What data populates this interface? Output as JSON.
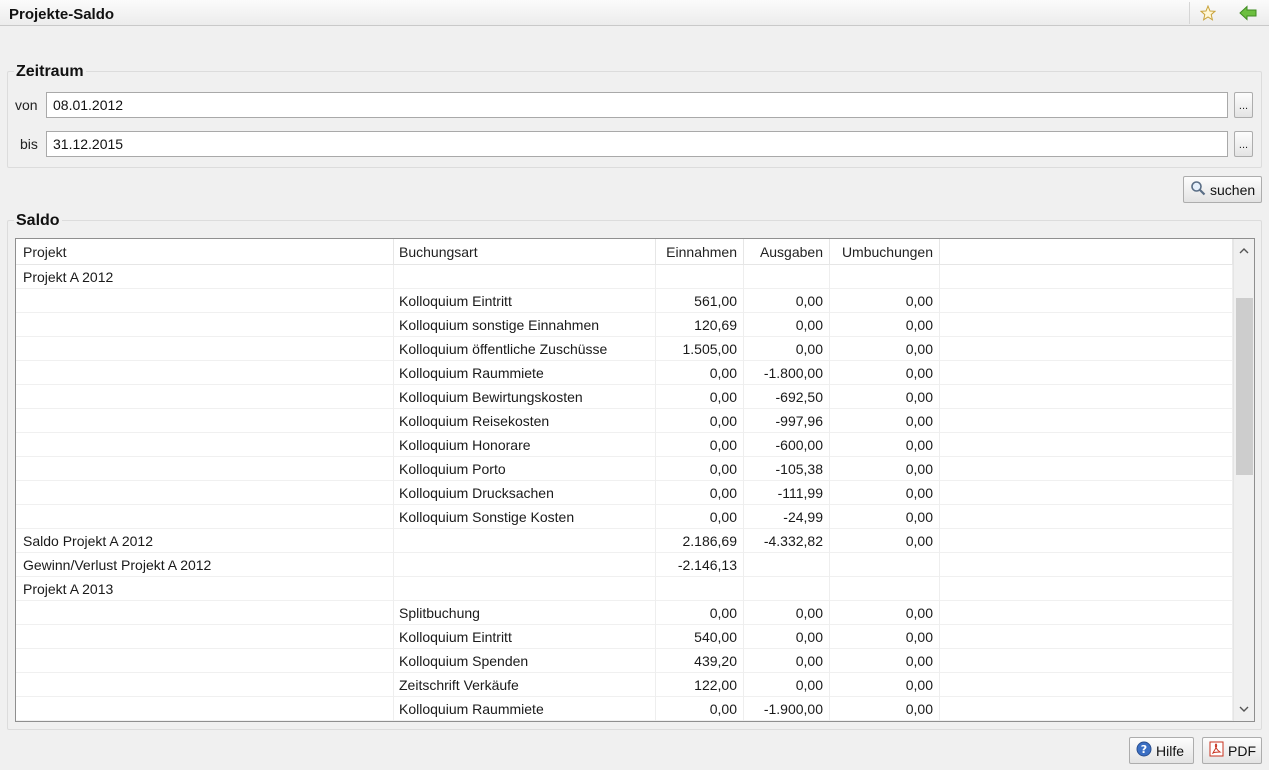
{
  "window": {
    "title": "Projekte-Saldo",
    "icons": [
      "star-icon",
      "back-arrow-icon"
    ]
  },
  "zeitraum": {
    "title": "Zeitraum",
    "von_label": "von",
    "von_value": "08.01.2012",
    "bis_label": "bis",
    "bis_value": "31.12.2015",
    "picker_label": "..."
  },
  "search": {
    "label": "suchen",
    "icon": "magnifier-icon"
  },
  "saldo": {
    "title": "Saldo",
    "columns": {
      "projekt": "Projekt",
      "buchungsart": "Buchungsart",
      "einnahmen": "Einnahmen",
      "ausgaben": "Ausgaben",
      "umbuchungen": "Umbuchungen"
    },
    "rows": [
      {
        "projekt": "Projekt A 2012",
        "buchungsart": "",
        "einnahmen": "",
        "ausgaben": "",
        "umbuchungen": ""
      },
      {
        "projekt": "",
        "buchungsart": "Kolloquium Eintritt",
        "einnahmen": "561,00",
        "ausgaben": "0,00",
        "umbuchungen": "0,00"
      },
      {
        "projekt": "",
        "buchungsart": "Kolloquium sonstige Einnahmen",
        "einnahmen": "120,69",
        "ausgaben": "0,00",
        "umbuchungen": "0,00"
      },
      {
        "projekt": "",
        "buchungsart": "Kolloquium öffentliche Zuschüsse",
        "einnahmen": "1.505,00",
        "ausgaben": "0,00",
        "umbuchungen": "0,00"
      },
      {
        "projekt": "",
        "buchungsart": "Kolloquium Raummiete",
        "einnahmen": "0,00",
        "ausgaben": "-1.800,00",
        "umbuchungen": "0,00"
      },
      {
        "projekt": "",
        "buchungsart": "Kolloquium Bewirtungskosten",
        "einnahmen": "0,00",
        "ausgaben": "-692,50",
        "umbuchungen": "0,00"
      },
      {
        "projekt": "",
        "buchungsart": "Kolloquium Reisekosten",
        "einnahmen": "0,00",
        "ausgaben": "-997,96",
        "umbuchungen": "0,00"
      },
      {
        "projekt": "",
        "buchungsart": "Kolloquium Honorare",
        "einnahmen": "0,00",
        "ausgaben": "-600,00",
        "umbuchungen": "0,00"
      },
      {
        "projekt": "",
        "buchungsart": "Kolloquium Porto",
        "einnahmen": "0,00",
        "ausgaben": "-105,38",
        "umbuchungen": "0,00"
      },
      {
        "projekt": "",
        "buchungsart": "Kolloquium Drucksachen",
        "einnahmen": "0,00",
        "ausgaben": "-111,99",
        "umbuchungen": "0,00"
      },
      {
        "projekt": "",
        "buchungsart": "Kolloquium Sonstige Kosten",
        "einnahmen": "0,00",
        "ausgaben": "-24,99",
        "umbuchungen": "0,00"
      },
      {
        "projekt": "Saldo Projekt A 2012",
        "buchungsart": "",
        "einnahmen": "2.186,69",
        "ausgaben": "-4.332,82",
        "umbuchungen": "0,00"
      },
      {
        "projekt": "Gewinn/Verlust Projekt A 2012",
        "buchungsart": "",
        "einnahmen": "-2.146,13",
        "ausgaben": "",
        "umbuchungen": ""
      },
      {
        "projekt": "Projekt A 2013",
        "buchungsart": "",
        "einnahmen": "",
        "ausgaben": "",
        "umbuchungen": ""
      },
      {
        "projekt": "",
        "buchungsart": "Splitbuchung",
        "einnahmen": "0,00",
        "ausgaben": "0,00",
        "umbuchungen": "0,00"
      },
      {
        "projekt": "",
        "buchungsart": "Kolloquium Eintritt",
        "einnahmen": "540,00",
        "ausgaben": "0,00",
        "umbuchungen": "0,00"
      },
      {
        "projekt": "",
        "buchungsart": "Kolloquium Spenden",
        "einnahmen": "439,20",
        "ausgaben": "0,00",
        "umbuchungen": "0,00"
      },
      {
        "projekt": "",
        "buchungsart": "Zeitschrift Verkäufe",
        "einnahmen": "122,00",
        "ausgaben": "0,00",
        "umbuchungen": "0,00"
      },
      {
        "projekt": "",
        "buchungsart": "Kolloquium Raummiete",
        "einnahmen": "0,00",
        "ausgaben": "-1.900,00",
        "umbuchungen": "0,00"
      }
    ]
  },
  "footer": {
    "help_label": "Hilfe",
    "pdf_label": "PDF"
  },
  "colors": {
    "background": "#f0f0f0",
    "table_background": "#ffffff",
    "border": "#8f8f8f",
    "scroll_thumb": "#cdcdcd"
  }
}
